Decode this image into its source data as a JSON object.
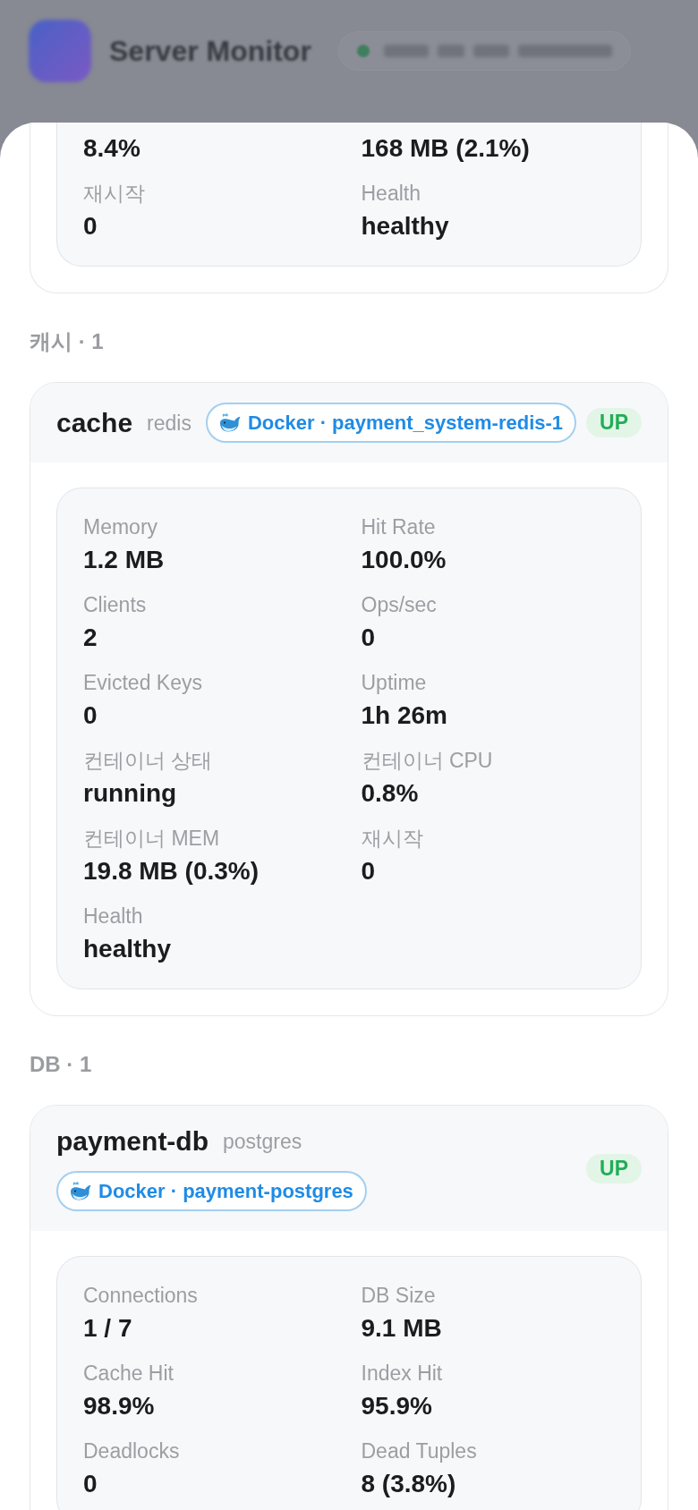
{
  "header": {
    "app_title": "Server Monitor"
  },
  "sheet": {
    "clipped_card": {
      "metrics": [
        {
          "value": "8.4%"
        },
        {
          "value": "168 MB (2.1%)"
        },
        {
          "label": "재시작",
          "value": "0"
        },
        {
          "label": "Health",
          "value": "healthy"
        }
      ]
    },
    "sections": [
      {
        "title": "캐시 · 1",
        "services": [
          {
            "name": "cache",
            "type": "redis",
            "source": "Docker · payment_system-redis-1",
            "status": "UP",
            "metrics": [
              {
                "label": "Memory",
                "value": "1.2 MB"
              },
              {
                "label": "Hit Rate",
                "value": "100.0%"
              },
              {
                "label": "Clients",
                "value": "2"
              },
              {
                "label": "Ops/sec",
                "value": "0"
              },
              {
                "label": "Evicted Keys",
                "value": "0"
              },
              {
                "label": "Uptime",
                "value": "1h 26m"
              },
              {
                "label": "컨테이너 상태",
                "value": "running"
              },
              {
                "label": "컨테이너 CPU",
                "value": "0.8%"
              },
              {
                "label": "컨테이너 MEM",
                "value": "19.8 MB (0.3%)"
              },
              {
                "label": "재시작",
                "value": "0"
              },
              {
                "label": "Health",
                "value": "healthy"
              }
            ]
          }
        ]
      },
      {
        "title": "DB · 1",
        "services": [
          {
            "name": "payment-db",
            "type": "postgres",
            "source": "Docker · payment-postgres",
            "status": "UP",
            "metrics": [
              {
                "label": "Connections",
                "value": "1 / 7"
              },
              {
                "label": "DB Size",
                "value": "9.1 MB"
              },
              {
                "label": "Cache Hit",
                "value": "98.9%"
              },
              {
                "label": "Index Hit",
                "value": "95.9%"
              },
              {
                "label": "Deadlocks",
                "value": "0"
              },
              {
                "label": "Dead Tuples",
                "value": "8 (3.8%)"
              }
            ]
          }
        ]
      }
    ]
  }
}
